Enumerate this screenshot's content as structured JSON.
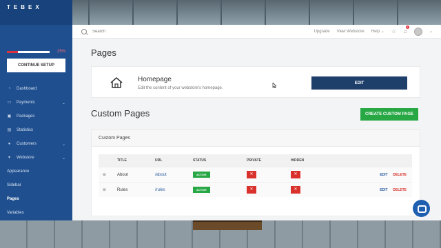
{
  "brand": {
    "logo_text": "TEBEX"
  },
  "setup": {
    "progress_percent": 25,
    "progress_label": "25%",
    "button_label": "CONTINUE SETUP"
  },
  "sidebar": {
    "items": [
      {
        "label": "Dashboard",
        "icon": "speedometer-icon",
        "has_chevron": false
      },
      {
        "label": "Payments",
        "icon": "credit-card-icon",
        "has_chevron": true
      },
      {
        "label": "Packages",
        "icon": "box-icon",
        "has_chevron": false
      },
      {
        "label": "Statistics",
        "icon": "bar-chart-icon",
        "has_chevron": false
      },
      {
        "label": "Customers",
        "icon": "users-icon",
        "has_chevron": true
      },
      {
        "label": "Webstore",
        "icon": "cart-icon",
        "has_chevron": true
      }
    ],
    "subitems": [
      {
        "label": "Appearance",
        "active": false
      },
      {
        "label": "Sidebar",
        "active": false
      },
      {
        "label": "Pages",
        "active": true
      },
      {
        "label": "Variables",
        "active": false
      }
    ]
  },
  "topbar": {
    "search_placeholder": "Search",
    "links": {
      "upgrade": "Upgrade",
      "view_webstore": "View Webstore",
      "help": "Help"
    },
    "notification_count": "1"
  },
  "main": {
    "page_title": "Pages",
    "homepage": {
      "title": "Homepage",
      "description": "Edit the content of your webstore's homepage.",
      "edit_label": "EDIT"
    },
    "custom_pages": {
      "section_title": "Custom Pages",
      "create_label": "CREATE CUSTOM PAGE",
      "card_title": "Custom Pages",
      "columns": [
        "TITLE",
        "URL",
        "STATUS",
        "PRIVATE",
        "HIDDEN"
      ],
      "rows": [
        {
          "title": "About",
          "url": "/about",
          "status": "ACTIVE",
          "private": "✕",
          "hidden": "✕",
          "edit": "EDIT",
          "delete": "DELETE"
        },
        {
          "title": "Rules",
          "url": "/rules",
          "status": "ACTIVE",
          "private": "✕",
          "hidden": "✕",
          "edit": "EDIT",
          "delete": "DELETE"
        }
      ]
    }
  },
  "colors": {
    "sidebar": "#1f4f8f",
    "primary_button": "#1f3f6b",
    "success": "#28a745",
    "danger": "#d9312b",
    "chat_button": "#1f5fb0"
  }
}
